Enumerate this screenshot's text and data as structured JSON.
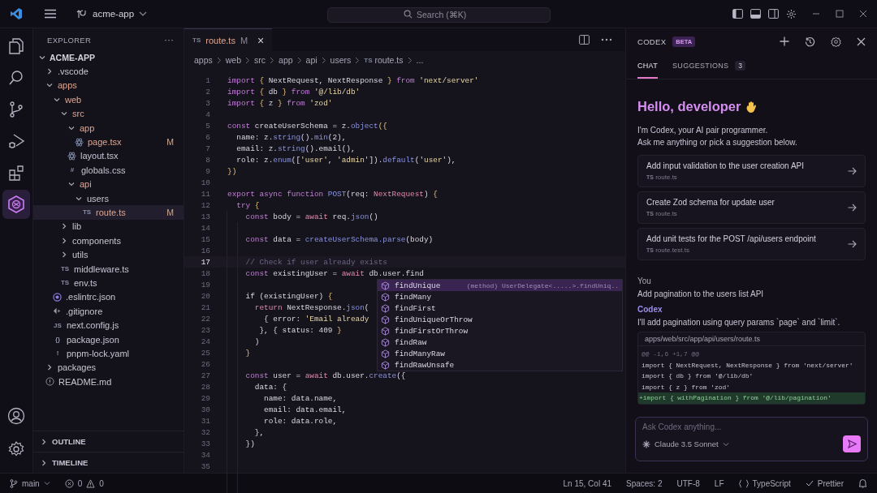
{
  "title_bar": {
    "workspace": "acme-app",
    "search": {
      "placeholder": "Search (⌘K)"
    }
  },
  "activity_bar": {
    "items": [
      {
        "selected": false
      },
      {
        "selected": false
      },
      {
        "selected": false
      },
      {
        "selected": false
      },
      {
        "selected": false
      },
      {
        "selected": true
      }
    ]
  },
  "sidebar": {
    "title": "EXPLORER",
    "more": "···",
    "root": {
      "name": "ACME-APP",
      "expanded": true
    },
    "tree": [
      {
        "name": ".vscode",
        "kind": "folder",
        "expanded": false,
        "modified": false
      },
      {
        "name": "apps",
        "kind": "folder",
        "expanded": true,
        "modified": true,
        "children": [
          {
            "name": "web",
            "kind": "folder",
            "expanded": true,
            "modified": true,
            "children": [
              {
                "name": "src",
                "kind": "folder",
                "expanded": true,
                "modified": true,
                "children": [
                  {
                    "name": "app",
                    "kind": "folder",
                    "expanded": true,
                    "modified": true,
                    "children": [
                      {
                        "name": "page.tsx",
                        "kind": "atom",
                        "status": "M",
                        "modified": true,
                        "selected": false
                      }
                    ]
                  },
                  {
                    "name": "layout.tsx",
                    "kind": "atom",
                    "modified": false,
                    "selected": false
                  },
                  {
                    "name": "globals.css",
                    "kind": "file",
                    "badge": "#",
                    "modified": false,
                    "selected": false
                  },
                  {
                    "name": "api",
                    "kind": "folder",
                    "expanded": true,
                    "modified": true,
                    "children": [
                      {
                        "name": "users",
                        "kind": "folder",
                        "expanded": true,
                        "modified": false,
                        "children": [
                          {
                            "name": "route.ts",
                            "kind": "file",
                            "badge": "TS",
                            "status": "M",
                            "modified": true,
                            "selected": true
                          }
                        ]
                      }
                    ]
                  }
                ]
              },
              {
                "name": "lib",
                "kind": "folder",
                "expanded": false,
                "modified": false
              },
              {
                "name": "components",
                "kind": "folder",
                "expanded": false,
                "modified": false
              },
              {
                "name": "utils",
                "kind": "folder",
                "expanded": false,
                "modified": false
              },
              {
                "name": "middleware.ts",
                "kind": "file",
                "badge": "TS",
                "modified": false,
                "selected": false
              },
              {
                "name": "env.ts",
                "kind": "file",
                "badge": "TS",
                "modified": false,
                "selected": false
              }
            ]
          },
          {
            "name": ".eslintrc.json",
            "kind": "ring",
            "modified": false,
            "selected": false
          },
          {
            "name": ".gitignore",
            "kind": "diamond",
            "modified": false,
            "selected": false
          },
          {
            "name": "next.config.js",
            "kind": "file",
            "badge": "JS",
            "modified": false,
            "selected": false
          },
          {
            "name": "package.json",
            "kind": "file",
            "badge": "{}",
            "modified": false,
            "selected": false
          },
          {
            "name": "pnpm-lock.yaml",
            "kind": "file",
            "badge": "!",
            "modified": false,
            "selected": false
          }
        ]
      },
      {
        "name": "packages",
        "kind": "folder",
        "expanded": false,
        "modified": false
      },
      {
        "name": "README.md",
        "kind": "info",
        "modified": false,
        "selected": false
      }
    ],
    "panels": [
      {
        "title": "OUTLINE",
        "expanded": false
      },
      {
        "title": "TIMELINE",
        "expanded": false
      }
    ]
  },
  "editor": {
    "tabs": [
      {
        "badge": "TS",
        "name": "route.ts",
        "status": "M",
        "selected": true,
        "close": "×"
      }
    ],
    "breadcrumb": [
      "apps",
      "web",
      "src",
      "app",
      "api",
      "users",
      "route.ts",
      "..."
    ],
    "breadcrumb_badge": "TS",
    "lines": [
      {
        "number": "1",
        "current": false,
        "tokens": [
          {
            "text": "import ",
            "kind": "keyword"
          },
          {
            "text": "{",
            "kind": "punct"
          },
          {
            "text": " NextRequest, NextResponse ",
            "kind": "plain"
          },
          {
            "text": "}",
            "kind": "punct"
          },
          {
            "text": " from ",
            "kind": "keyword"
          },
          {
            "text": "'next/server'",
            "kind": "string"
          }
        ]
      },
      {
        "number": "2",
        "current": false,
        "tokens": [
          {
            "text": "import ",
            "kind": "keyword"
          },
          {
            "text": "{",
            "kind": "punct"
          },
          {
            "text": " db ",
            "kind": "plain"
          },
          {
            "text": "}",
            "kind": "punct"
          },
          {
            "text": " from ",
            "kind": "keyword"
          },
          {
            "text": "'@/lib/db'",
            "kind": "string"
          }
        ]
      },
      {
        "number": "3",
        "current": false,
        "tokens": [
          {
            "text": "import ",
            "kind": "keyword"
          },
          {
            "text": "{",
            "kind": "punct"
          },
          {
            "text": " z ",
            "kind": "plain"
          },
          {
            "text": "}",
            "kind": "punct"
          },
          {
            "text": " from ",
            "kind": "keyword"
          },
          {
            "text": "'zod'",
            "kind": "string"
          }
        ]
      },
      {
        "number": "4",
        "current": false
      },
      {
        "number": "5",
        "current": false,
        "tokens": [
          {
            "text": "const ",
            "kind": "keyword"
          },
          {
            "text": "createUserSchema = z.",
            "kind": "plain"
          },
          {
            "text": "object",
            "kind": "call"
          },
          {
            "text": "({",
            "kind": "punct"
          }
        ]
      },
      {
        "number": "6",
        "current": false,
        "tokens": [
          {
            "text": "  name: z.",
            "kind": "plain"
          },
          {
            "text": "string",
            "kind": "call"
          },
          {
            "text": "().",
            "kind": "plain"
          },
          {
            "text": "min",
            "kind": "call"
          },
          {
            "text": "(2),",
            "kind": "plain"
          }
        ]
      },
      {
        "number": "7",
        "current": false,
        "tokens": [
          {
            "text": "  email: z.",
            "kind": "plain"
          },
          {
            "text": "string",
            "kind": "call"
          },
          {
            "text": "().email(),",
            "kind": "plain"
          }
        ]
      },
      {
        "number": "8",
        "current": false,
        "tokens": [
          {
            "text": "  role: z.",
            "kind": "plain"
          },
          {
            "text": "enum",
            "kind": "call"
          },
          {
            "text": "([",
            "kind": "plain"
          },
          {
            "text": "'user'",
            "kind": "string"
          },
          {
            "text": ", ",
            "kind": "plain"
          },
          {
            "text": "'admin'",
            "kind": "string"
          },
          {
            "text": "]).",
            "kind": "plain"
          },
          {
            "text": "default",
            "kind": "call"
          },
          {
            "text": "(",
            "kind": "plain"
          },
          {
            "text": "'user'",
            "kind": "string"
          },
          {
            "text": "),",
            "kind": "plain"
          }
        ]
      },
      {
        "number": "9",
        "current": false,
        "tokens": [
          {
            "text": "})",
            "kind": "punct"
          }
        ]
      },
      {
        "number": "10",
        "current": false
      },
      {
        "number": "11",
        "current": false,
        "tokens": [
          {
            "text": "export async function ",
            "kind": "keyword"
          },
          {
            "text": "POST",
            "kind": "call"
          },
          {
            "text": "(req: ",
            "kind": "plain"
          },
          {
            "text": "NextRequest",
            "kind": "type"
          },
          {
            "text": ") ",
            "kind": "plain"
          },
          {
            "text": "{",
            "kind": "punct"
          }
        ]
      },
      {
        "number": "12",
        "current": false,
        "tokens": [
          {
            "text": "  try ",
            "kind": "keyword"
          },
          {
            "text": "{",
            "kind": "punct"
          }
        ]
      },
      {
        "number": "13",
        "current": false,
        "tokens": [
          {
            "text": "    const ",
            "kind": "keyword"
          },
          {
            "text": "body = ",
            "kind": "plain"
          },
          {
            "text": "await ",
            "kind": "type"
          },
          {
            "text": "req.",
            "kind": "plain"
          },
          {
            "text": "json",
            "kind": "call"
          },
          {
            "text": "()",
            "kind": "plain"
          }
        ]
      },
      {
        "number": "14",
        "current": false
      },
      {
        "number": "15",
        "current": false,
        "tokens": [
          {
            "text": "    const ",
            "kind": "keyword"
          },
          {
            "text": "data = ",
            "kind": "plain"
          },
          {
            "text": "createUserSchema.parse",
            "kind": "call"
          },
          {
            "text": "(body)",
            "kind": "plain"
          }
        ]
      },
      {
        "number": "16",
        "current": false
      },
      {
        "number": "17",
        "current": true,
        "tokens": [
          {
            "text": "    // Check if user already exists",
            "kind": "comment"
          }
        ]
      },
      {
        "number": "18",
        "current": false,
        "tokens": [
          {
            "text": "    const ",
            "kind": "keyword"
          },
          {
            "text": "existingUser = ",
            "kind": "plain"
          },
          {
            "text": "await ",
            "kind": "type"
          },
          {
            "text": "db.user.find",
            "kind": "plain"
          }
        ]
      },
      {
        "number": "19",
        "current": false
      },
      {
        "number": "20",
        "current": false,
        "tokens": [
          {
            "text": "    if (existingUser) ",
            "kind": "plain"
          },
          {
            "text": "{",
            "kind": "punct"
          }
        ]
      },
      {
        "number": "21",
        "current": false,
        "tokens": [
          {
            "text": "      return ",
            "kind": "type"
          },
          {
            "text": "NextResponse.",
            "kind": "plain"
          },
          {
            "text": "json",
            "kind": "call"
          },
          {
            "text": "(",
            "kind": "plain"
          }
        ]
      },
      {
        "number": "22",
        "current": false,
        "tokens": [
          {
            "text": "        { error: ",
            "kind": "plain"
          },
          {
            "text": "'Email already",
            "kind": "string"
          }
        ]
      },
      {
        "number": "23",
        "current": false,
        "tokens": [
          {
            "text": "       }, { status: 409 ",
            "kind": "plain"
          },
          {
            "text": "}",
            "kind": "punct"
          }
        ]
      },
      {
        "number": "24",
        "current": false,
        "tokens": [
          {
            "text": "      )",
            "kind": "plain"
          }
        ]
      },
      {
        "number": "25",
        "current": false,
        "tokens": [
          {
            "text": "    }",
            "kind": "punct"
          }
        ]
      },
      {
        "number": "26",
        "current": false
      },
      {
        "number": "27",
        "current": false,
        "tokens": [
          {
            "text": "    const ",
            "kind": "keyword"
          },
          {
            "text": "user = ",
            "kind": "plain"
          },
          {
            "text": "await ",
            "kind": "type"
          },
          {
            "text": "db.user.",
            "kind": "plain"
          },
          {
            "text": "create",
            "kind": "call"
          },
          {
            "text": "({",
            "kind": "plain"
          }
        ]
      },
      {
        "number": "28",
        "current": false,
        "tokens": [
          {
            "text": "      data: {",
            "kind": "plain"
          }
        ]
      },
      {
        "number": "29",
        "current": false,
        "tokens": [
          {
            "text": "        name: data.name,",
            "kind": "plain"
          }
        ]
      },
      {
        "number": "30",
        "current": false,
        "tokens": [
          {
            "text": "        email: data.email,",
            "kind": "plain"
          }
        ]
      },
      {
        "number": "31",
        "current": false,
        "tokens": [
          {
            "text": "        role: data.role,",
            "kind": "plain"
          }
        ]
      },
      {
        "number": "32",
        "current": false,
        "tokens": [
          {
            "text": "      },",
            "kind": "plain"
          }
        ]
      },
      {
        "number": "33",
        "current": false,
        "tokens": [
          {
            "text": "    })",
            "kind": "plain"
          }
        ]
      },
      {
        "number": "34",
        "current": false
      },
      {
        "number": "35",
        "current": false
      }
    ],
    "suggest": [
      {
        "label": "findUnique",
        "selected": true,
        "detail": "(method) UserDelegate<.....>.findUniq.."
      },
      {
        "label": "findMany",
        "selected": false
      },
      {
        "label": "findFirst",
        "selected": false
      },
      {
        "label": "findUniqueOrThrow",
        "selected": false
      },
      {
        "label": "findFirstOrThrow",
        "selected": false
      },
      {
        "label": "findRaw",
        "selected": false
      },
      {
        "label": "findManyRaw",
        "selected": false
      },
      {
        "label": "findRawUnsafe",
        "selected": false
      }
    ]
  },
  "assistant": {
    "title": "CODEX",
    "badge": "BETA",
    "tabs": [
      {
        "label": "CHAT",
        "selected": true
      },
      {
        "label": "SUGGESTIONS",
        "count": "3",
        "selected": false
      }
    ],
    "greeting": "Hello, developer",
    "intro": [
      "I'm Codex, your AI pair programmer.",
      "Ask me anything or pick a suggestion below."
    ],
    "suggestions": [
      {
        "title": "Add input validation to the user creation API",
        "badge": "TS",
        "file": "route.ts"
      },
      {
        "title": "Create Zod schema for update user",
        "badge": "TS",
        "file": "route.ts"
      },
      {
        "title": "Add unit tests for the POST /api/users endpoint",
        "badge": "TS",
        "file": "route.test.ts"
      }
    ],
    "messages": [
      {
        "author": "You",
        "text": "Add pagination to the users list API"
      },
      {
        "author": "Codex",
        "text": "I'll add pagination using query params `page` and `limit`."
      }
    ],
    "diff": {
      "path": "apps/web/src/app/api/users/route.ts",
      "lines": [
        {
          "kind": "hunk",
          "text": "@@ -1,6 +1,7 @@"
        },
        {
          "kind": "context",
          "text": "import { NextRequest, NextResponse } from 'next/server'"
        },
        {
          "kind": "context",
          "text": "import { db } from '@/lib/db'"
        },
        {
          "kind": "context",
          "text": "import { z } from 'zod'"
        },
        {
          "kind": "added",
          "text": "+import { withPagination } from '@/lib/pagination'"
        }
      ]
    },
    "input": {
      "placeholder": "Ask Codex anything...",
      "model": "Claude 3.5 Sonnet"
    }
  },
  "status_bar": {
    "branch": "main",
    "errors": "0",
    "warnings": "0",
    "items": [
      "Ln 15, Col 41",
      "Spaces: 2",
      "UTF-8",
      "LF"
    ],
    "language": "TypeScript",
    "formatter": "Prettier"
  }
}
